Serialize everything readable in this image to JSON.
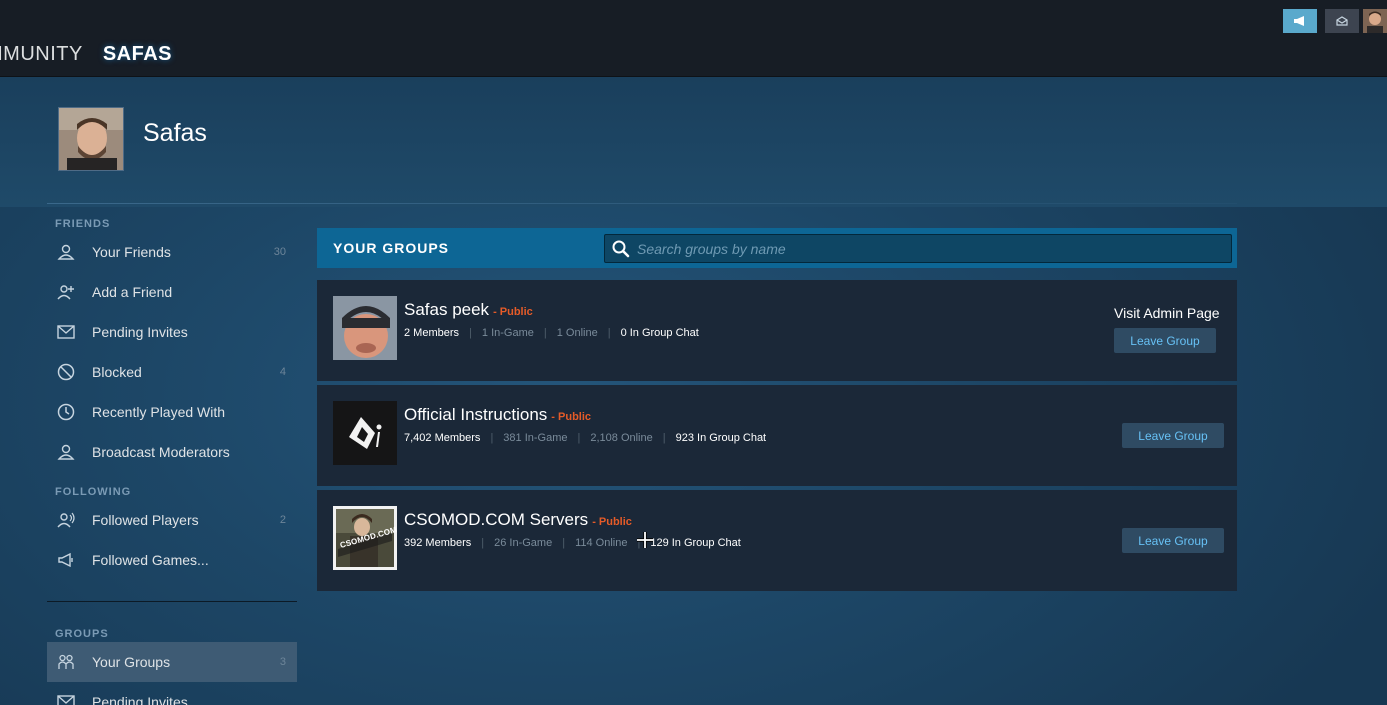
{
  "nav": {
    "items": [
      {
        "label": "MMUNITY",
        "active": false
      },
      {
        "label": "SAFAS",
        "active": true
      }
    ]
  },
  "topbar": {
    "announcement_icon": "megaphone-icon",
    "notification_icon": "envelope-icon",
    "avatar_icon": "user-avatar"
  },
  "profile": {
    "name": "Safas"
  },
  "sidebar": {
    "sections": [
      {
        "heading": "FRIENDS",
        "items": [
          {
            "label": "Your Friends",
            "count": "30",
            "icon": "person-icon"
          },
          {
            "label": "Add a Friend",
            "count": "",
            "icon": "add-person-icon"
          },
          {
            "label": "Pending Invites",
            "count": "",
            "icon": "envelope-icon"
          },
          {
            "label": "Blocked",
            "count": "4",
            "icon": "blocked-icon"
          },
          {
            "label": "Recently Played With",
            "count": "",
            "icon": "clock-icon"
          },
          {
            "label": "Broadcast Moderators",
            "count": "",
            "icon": "person-icon"
          }
        ]
      },
      {
        "heading": "FOLLOWING",
        "items": [
          {
            "label": "Followed Players",
            "count": "2",
            "icon": "followed-person-icon"
          },
          {
            "label": "Followed Games...",
            "count": "",
            "icon": "megaphone-icon"
          }
        ]
      },
      {
        "heading": "GROUPS",
        "items": [
          {
            "label": "Your Groups",
            "count": "3",
            "icon": "group-icon",
            "active": true
          },
          {
            "label": "Pending Invites",
            "count": "",
            "icon": "envelope-icon"
          }
        ]
      }
    ]
  },
  "groups": {
    "title": "YOUR GROUPS",
    "search_placeholder": "Search groups by name",
    "search_value": "",
    "leave_label": "Leave Group",
    "admin_label": "Visit Admin Page",
    "list": [
      {
        "name": "Safas peek",
        "visibility": "- Public",
        "members": "2 Members",
        "in_game": "1 In-Game",
        "online": "1 Online",
        "in_chat": "0 In Group Chat",
        "is_admin": true
      },
      {
        "name": "Official Instructions",
        "visibility": "- Public",
        "members": "7,402 Members",
        "in_game": "381 In-Game",
        "online": "2,108 Online",
        "in_chat": "923 In Group Chat",
        "is_admin": false
      },
      {
        "name": "CSOMOD.COM Servers",
        "visibility": "- Public",
        "members": "392 Members",
        "in_game": "26 In-Game",
        "online": "114 Online",
        "in_chat": "129 In Group Chat",
        "is_admin": false,
        "avatar_text": "CSOMOD.COM"
      }
    ]
  },
  "colors": {
    "accent": "#67c1f5",
    "public_badge": "#e55b28",
    "header_bar": "#0d6695"
  }
}
